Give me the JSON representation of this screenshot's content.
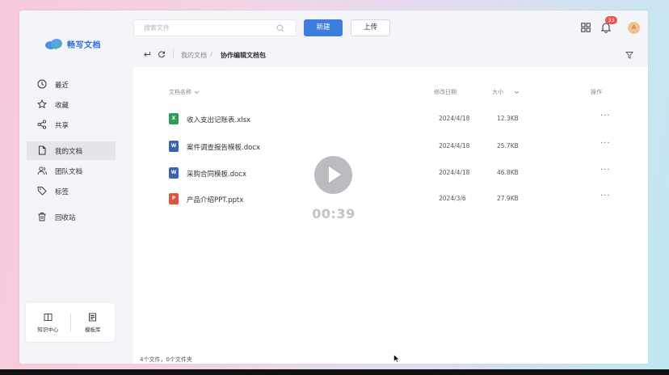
{
  "app": {
    "logo_text": "畅写文档"
  },
  "sidebar": {
    "items": [
      {
        "label": "最近",
        "icon": "clock-icon"
      },
      {
        "label": "收藏",
        "icon": "star-icon"
      },
      {
        "label": "共享",
        "icon": "share-icon"
      },
      {
        "label": "我的文档",
        "icon": "document-icon",
        "active": true
      },
      {
        "label": "团队文档",
        "icon": "team-icon"
      },
      {
        "label": "标签",
        "icon": "tag-icon"
      },
      {
        "label": "回收站",
        "icon": "trash-icon"
      }
    ],
    "bottom": {
      "knowledge_label": "知识中心",
      "template_label": "模板库"
    }
  },
  "toolbar": {
    "search_placeholder": "搜索文件",
    "new_label": "新建",
    "upload_label": "上传",
    "notification_count": "33",
    "avatar_letter": "A"
  },
  "breadcrumb": {
    "root": "我的文档",
    "separator": "/",
    "current": "协作编辑文档包"
  },
  "table": {
    "headers": {
      "name": "文档名称",
      "date": "修改日期",
      "size": "大小",
      "actions": "操作"
    },
    "rows": [
      {
        "name": "收入支出记账表.xlsx",
        "date": "2024/4/18",
        "size": "12.3KB",
        "type": "excel",
        "badge": "X",
        "color": "#2e9d5b"
      },
      {
        "name": "案件调查报告模板.docx",
        "date": "2024/4/18",
        "size": "25.7KB",
        "type": "word",
        "badge": "W",
        "color": "#3a62b8"
      },
      {
        "name": "采购合同模板.docx",
        "date": "2024/4/18",
        "size": "46.8KB",
        "type": "word",
        "badge": "W",
        "color": "#3a62b8"
      },
      {
        "name": "产品介绍PPT.pptx",
        "date": "2024/3/6",
        "size": "27.9KB",
        "type": "ppt",
        "badge": "P",
        "color": "#e0533e"
      }
    ],
    "more_glyph": "···"
  },
  "footer": {
    "summary": "4个文件，0个文件夹"
  },
  "video": {
    "timestamp": "00:39"
  },
  "colors": {
    "accent": "#3e7de0",
    "badge_red": "#f05252"
  }
}
